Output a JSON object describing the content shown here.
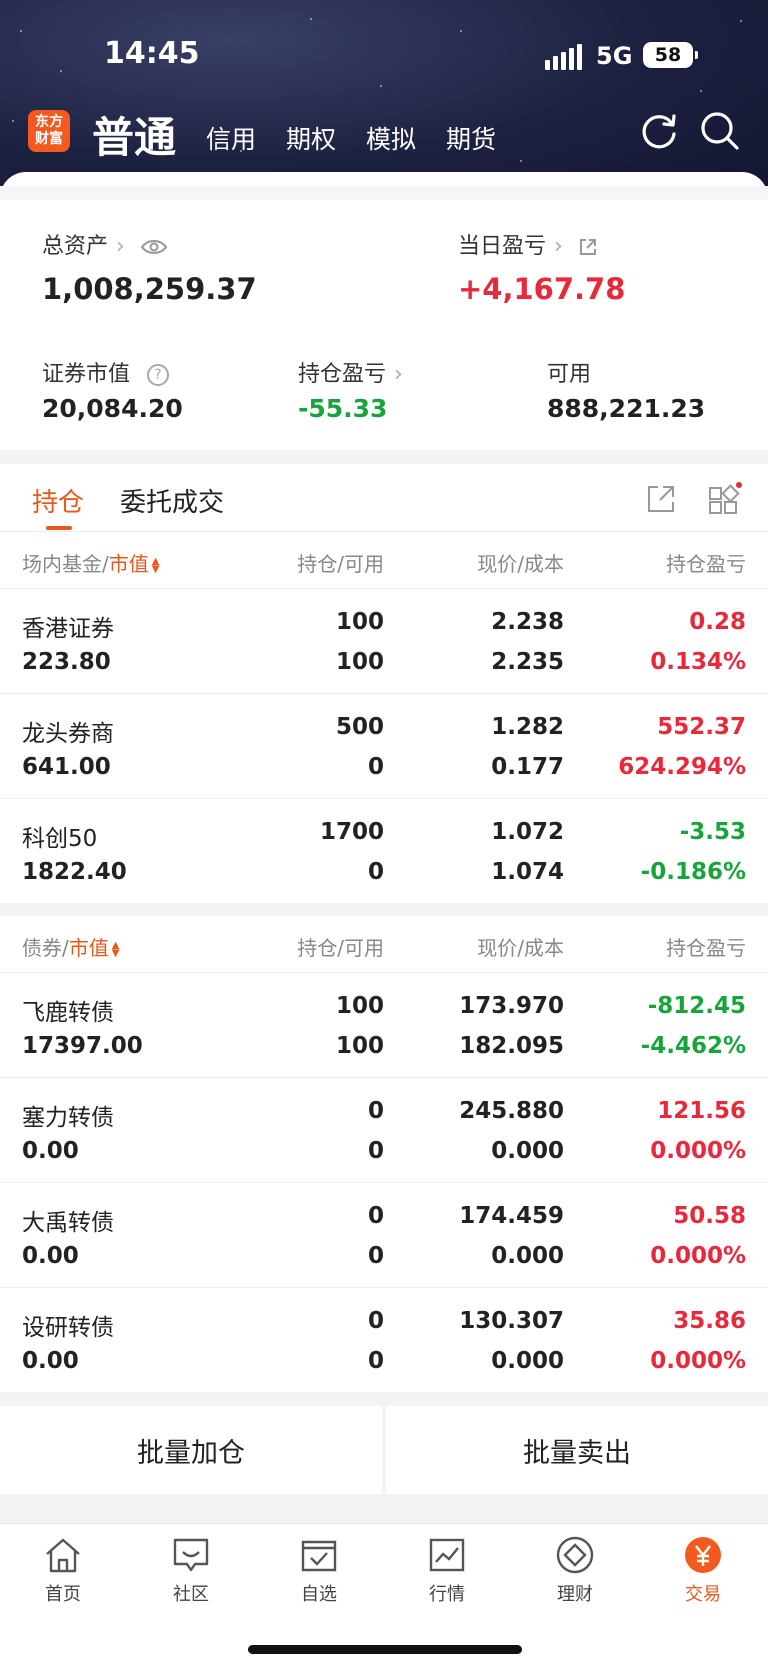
{
  "status": {
    "time": "14:45",
    "network": "5G",
    "battery": "58"
  },
  "header": {
    "logo": "东方财富",
    "active_tab": "普通",
    "tabs": [
      "信用",
      "期权",
      "模拟",
      "期货"
    ]
  },
  "summary": {
    "total_assets_label": "总资产",
    "total_assets": "1,008,259.37",
    "daily_pnl_label": "当日盈亏",
    "daily_pnl": "+4,167.78",
    "market_value_label": "证券市值",
    "market_value": "20,084.20",
    "position_pnl_label": "持仓盈亏",
    "position_pnl": "-55.33",
    "available_label": "可用",
    "available": "888,221.23"
  },
  "tabs": {
    "positions": "持仓",
    "orders": "委托成交"
  },
  "funds": {
    "header": {
      "category": "场内基金",
      "sort": "市值",
      "qty": "持仓/可用",
      "price": "现价/成本",
      "pnl": "持仓盈亏"
    },
    "rows": [
      {
        "name": "香港证券",
        "mv": "223.80",
        "hold": "100",
        "avail": "100",
        "price": "2.238",
        "cost": "2.235",
        "pnl": "0.28",
        "pct": "0.134%",
        "dir": "up"
      },
      {
        "name": "龙头券商",
        "mv": "641.00",
        "hold": "500",
        "avail": "0",
        "price": "1.282",
        "cost": "0.177",
        "pnl": "552.37",
        "pct": "624.294%",
        "dir": "up"
      },
      {
        "name": "科创50",
        "mv": "1822.40",
        "hold": "1700",
        "avail": "0",
        "price": "1.072",
        "cost": "1.074",
        "pnl": "-3.53",
        "pct": "-0.186%",
        "dir": "down"
      }
    ]
  },
  "bonds": {
    "header": {
      "category": "债券",
      "sort": "市值",
      "qty": "持仓/可用",
      "price": "现价/成本",
      "pnl": "持仓盈亏"
    },
    "rows": [
      {
        "name": "飞鹿转债",
        "mv": "17397.00",
        "hold": "100",
        "avail": "100",
        "price": "173.970",
        "cost": "182.095",
        "pnl": "-812.45",
        "pct": "-4.462%",
        "dir": "down"
      },
      {
        "name": "塞力转债",
        "mv": "0.00",
        "hold": "0",
        "avail": "0",
        "price": "245.880",
        "cost": "0.000",
        "pnl": "121.56",
        "pct": "0.000%",
        "dir": "up"
      },
      {
        "name": "大禹转债",
        "mv": "0.00",
        "hold": "0",
        "avail": "0",
        "price": "174.459",
        "cost": "0.000",
        "pnl": "50.58",
        "pct": "0.000%",
        "dir": "up"
      },
      {
        "name": "设研转债",
        "mv": "0.00",
        "hold": "0",
        "avail": "0",
        "price": "130.307",
        "cost": "0.000",
        "pnl": "35.86",
        "pct": "0.000%",
        "dir": "up"
      }
    ]
  },
  "actions": {
    "batch_buy": "批量加仓",
    "batch_sell": "批量卖出"
  },
  "nav": [
    "首页",
    "社区",
    "自选",
    "行情",
    "理财",
    "交易"
  ],
  "colors": {
    "accent": "#e8591b",
    "up": "#e8283b",
    "down": "#17a53b"
  }
}
